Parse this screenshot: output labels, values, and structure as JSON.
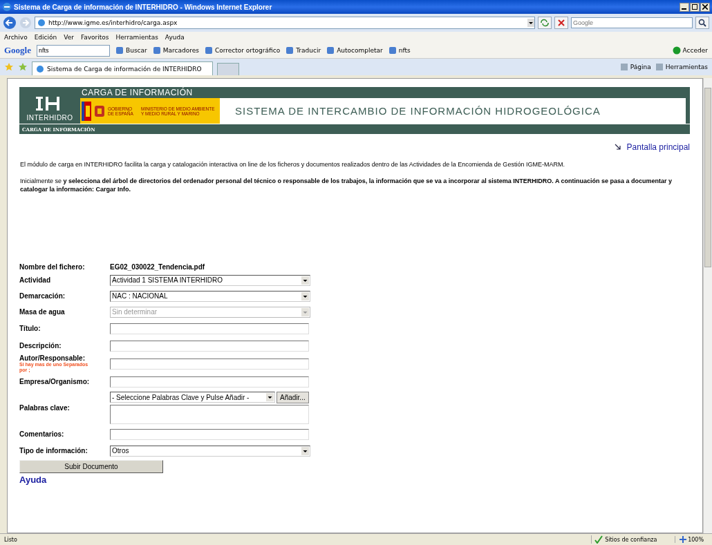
{
  "window": {
    "title": "Sistema de Carga de información de INTERHIDRO - Windows Internet Explorer"
  },
  "address_bar": {
    "url": "http://www.igme.es/interhidro/carga.aspx"
  },
  "search_box": {
    "placeholder": "Google"
  },
  "menu": [
    "Archivo",
    "Edición",
    "Ver",
    "Favoritos",
    "Herramientas",
    "Ayuda"
  ],
  "google_toolbar": {
    "logo": "Google",
    "query": "nfts",
    "items": [
      "Buscar",
      "Marcadores",
      "Corrector ortográfico",
      "Traducir",
      "Autocompletar",
      "nfts"
    ],
    "sign_in": "Acceder"
  },
  "tab": {
    "label": "Sistema de Carga de información de INTERHIDRO",
    "selected": true
  },
  "command_bar": [
    "Página",
    "Herramientas"
  ],
  "page": {
    "logo_text": "INTERHIDRO",
    "header_title": "CARGA DE INFORMACIÓN",
    "gov_label": "GOBIERNO DE ESPAÑA",
    "ministry_label": "MINISTERIO DE MEDIO AMBIENTE Y MEDIO RURAL Y MARINO",
    "banner": "SISTEMA DE INTERCAMBIO DE INFORMACIÓN HIDROGEOLÓGICA",
    "section_bar": "CARGA DE INFORMACIÓN",
    "home_link": "Pantalla principal",
    "paragraphs": [
      "El módulo de carga en INTERHIDRO facilita la carga y catalogación interactiva on line de los ficheros y documentos realizados dentro de las Actividades de  la Encomienda de Gestión IGME-MARM.",
      "Inicialmente se **y selecciona del árbol de directorios del ordenador personal del técnico o responsable de los trabajos, la información que se va a incorporar al sistema INTERHIDRO. A continuación se pasa a documentar  y catalogar  la información:  Cargar Info.**"
    ],
    "form": [
      {
        "kind": "static",
        "label": "Nombre del fichero:",
        "value": "EG02_030022_Tendencia.pdf"
      },
      {
        "kind": "select",
        "label": "Actividad",
        "value": "Actividad 1 SISTEMA INTERHIDRO",
        "disabled": false
      },
      {
        "kind": "select",
        "label": "Demarcación:",
        "value": "NAC : NACIONAL",
        "disabled": false
      },
      {
        "kind": "select",
        "label": "Masa de agua",
        "value": "Sin determinar",
        "disabled": true
      },
      {
        "kind": "input",
        "label": "Título:"
      },
      {
        "kind": "input",
        "label": "Descripción:"
      },
      {
        "kind": "input",
        "label": "Autor/Responsable:",
        "note": "Si hay mas de uno Separados por ;"
      },
      {
        "kind": "input",
        "label": "Empresa/Organismo:"
      },
      {
        "kind": "keywords",
        "label": "Palabras clave:",
        "value": "- Seleccione Palabras Clave y Pulse Añadir -",
        "button": "Añadir..."
      },
      {
        "kind": "input",
        "label": "Comentarios:"
      },
      {
        "kind": "select",
        "label": "Tipo de información:",
        "value": "Otros",
        "disabled": false
      }
    ],
    "submit": "Subir Documento",
    "help": "Ayuda"
  },
  "status_bar": {
    "text": "Listo",
    "zone": "Sitios de confianza",
    "zoom": "100%"
  }
}
